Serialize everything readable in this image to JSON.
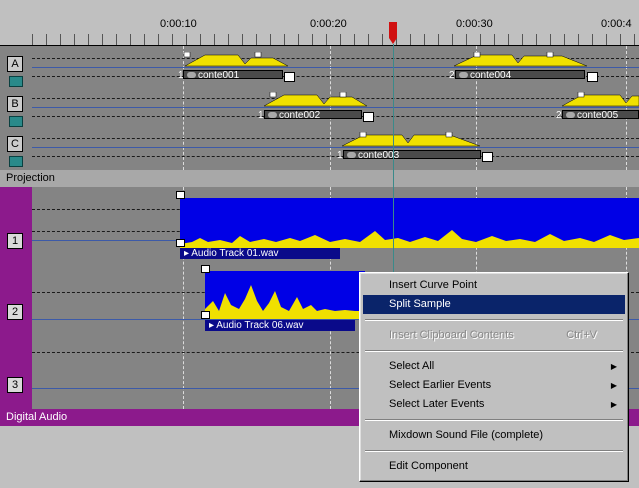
{
  "ruler": {
    "labels": [
      "0:00:10",
      "0:00:20",
      "0:00:30",
      "0:00:4"
    ]
  },
  "sequence_tracks": [
    {
      "letter": "A",
      "clips": [
        {
          "num": "1",
          "name": "conte001"
        },
        {
          "num": "2",
          "name": "conte004"
        }
      ]
    },
    {
      "letter": "B",
      "clips": [
        {
          "num": "1",
          "name": "conte002"
        },
        {
          "num": "2",
          "name": "conte005"
        }
      ]
    },
    {
      "letter": "C",
      "clips": [
        {
          "num": "1",
          "name": "conte003"
        }
      ]
    }
  ],
  "projection_label": "Projection",
  "audio_tracks": [
    {
      "num": "1",
      "clip": "Audio Track 01.wav"
    },
    {
      "num": "2",
      "clip": "Audio Track 06.wav"
    },
    {
      "num": "3",
      "clip": ""
    }
  ],
  "digital_audio_label": "Digital Audio",
  "context_menu": {
    "items": [
      {
        "label": "Insert Curve Point"
      },
      {
        "label": "Split Sample"
      },
      {
        "label": "Insert Clipboard Contents",
        "shortcut": "Ctrl+V"
      },
      {
        "label": "Select All"
      },
      {
        "label": "Select Earlier Events"
      },
      {
        "label": "Select Later Events"
      },
      {
        "label": "Mixdown Sound File (complete)"
      },
      {
        "label": "Edit Component"
      }
    ],
    "highlighted": "Split Sample",
    "disabled": "Insert Clipboard Contents"
  },
  "colors": {
    "waveform_bg": "#0000e6",
    "waveform_peaks": "#f0e000",
    "audio_strip": "#8c1a8c",
    "menu_highlight": "#0a246a",
    "playhead": "#d01010"
  },
  "icons": [
    "playhead-marker-icon",
    "track-camera-icon",
    "clip-end-icon",
    "clip-play-icon",
    "submenu-arrow-icon"
  ]
}
